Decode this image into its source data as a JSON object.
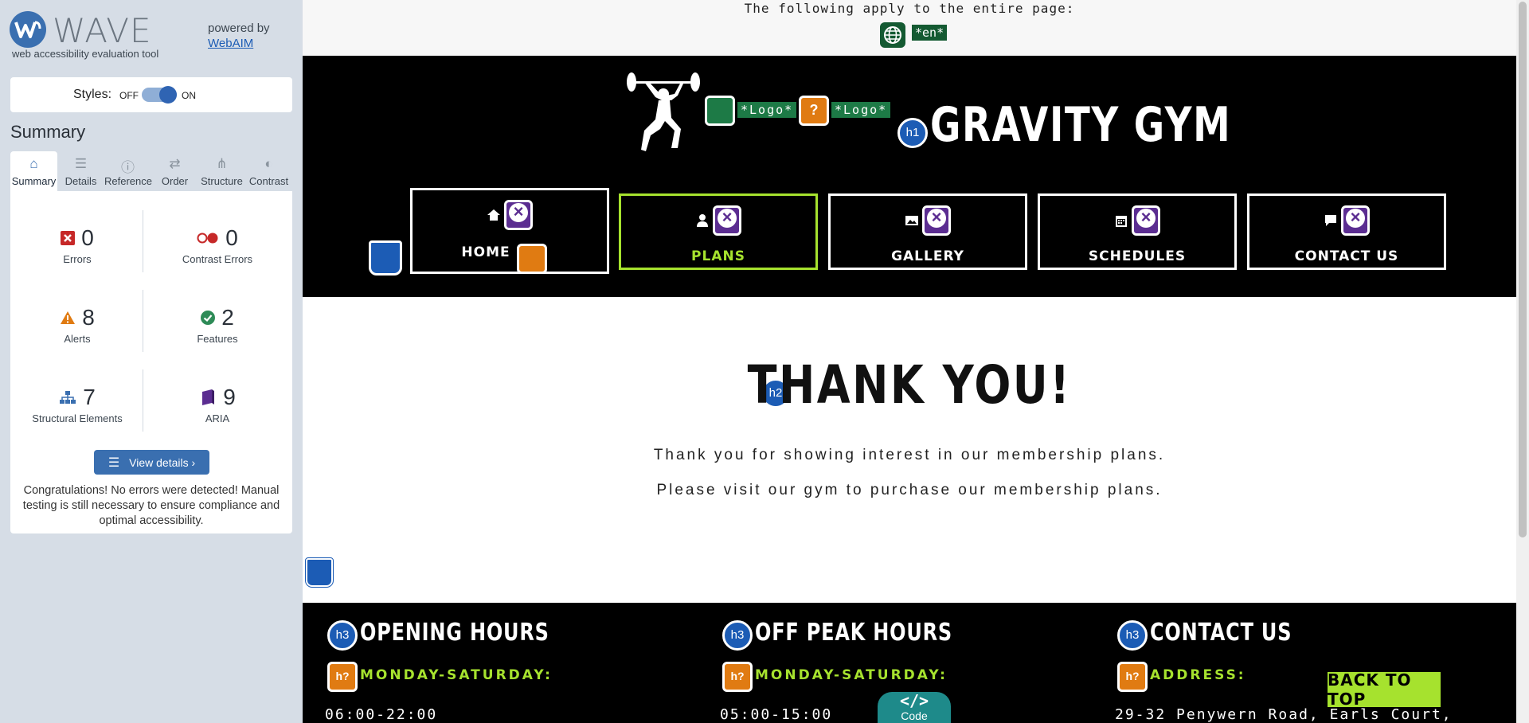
{
  "wave": {
    "name": "WAVE",
    "tagline": "web accessibility evaluation tool",
    "powered_by": "powered by",
    "webaim": "WebAIM",
    "styles_label": "Styles:",
    "styles_off": "OFF",
    "styles_on": "ON",
    "summary_title": "Summary",
    "tabs": [
      {
        "label": "Summary",
        "icon": "home-icon"
      },
      {
        "label": "Details",
        "icon": "list-icon"
      },
      {
        "label": "Reference",
        "icon": "info-icon"
      },
      {
        "label": "Order",
        "icon": "order-icon"
      },
      {
        "label": "Structure",
        "icon": "structure-icon"
      },
      {
        "label": "Contrast",
        "icon": "contrast-icon"
      }
    ],
    "stats": {
      "errors": {
        "value": "0",
        "label": "Errors"
      },
      "contrast_errors": {
        "value": "0",
        "label": "Contrast Errors"
      },
      "alerts": {
        "value": "8",
        "label": "Alerts"
      },
      "features": {
        "value": "2",
        "label": "Features"
      },
      "structural": {
        "value": "7",
        "label": "Structural Elements"
      },
      "aria": {
        "value": "9",
        "label": "ARIA"
      }
    },
    "view_details": "View details ›",
    "congrats": "Congratulations! No errors were detected! Manual testing is still necessary to ensure compliance and optimal accessibility."
  },
  "page": {
    "lang_notice": "The following apply to the entire page:",
    "lang_code": "*en*",
    "logo_alt_1": "*Logo*",
    "logo_alt_2": "*Logo*",
    "site_title": "GRAVITY GYM",
    "nav": [
      {
        "label": "HOME",
        "icon": "home-icon"
      },
      {
        "label": "PLANS",
        "icon": "user-icon"
      },
      {
        "label": "GALLERY",
        "icon": "image-icon"
      },
      {
        "label": "SCHEDULES",
        "icon": "calendar-icon"
      },
      {
        "label": "CONTACT US",
        "icon": "chat-icon"
      }
    ],
    "thank_title": "THANK YOU!",
    "thank_p1": "Thank you for showing interest in our membership plans.",
    "thank_p2": "Please visit our gym to purchase our membership plans.",
    "footer": {
      "col1_head": "OPENING HOURS",
      "col1_sub": "MONDAY-SATURDAY:",
      "col1_val": "06:00-22:00",
      "col2_head": "OFF PEAK HOURS",
      "col2_sub": "MONDAY-SATURDAY:",
      "col2_val": "05:00-15:00",
      "col3_head": "CONTACT US",
      "col3_sub": "ADDRESS:",
      "col3_val": "29-32 Penywern Road, Earls Court,"
    },
    "back_to_top": "BACK TO TOP",
    "code_tab": "Code",
    "code_icon": "</>",
    "badges": {
      "h1": "h1",
      "h2": "h2",
      "h3": "h3",
      "h_question": "h?",
      "question": "?"
    }
  },
  "colors": {
    "accent_green": "#a6e22e",
    "wave_blue": "#3a6fb0",
    "error_red": "#c62828",
    "alert_orange": "#e07b12",
    "feature_green": "#2e8b57",
    "aria_purple": "#5b2d91"
  }
}
